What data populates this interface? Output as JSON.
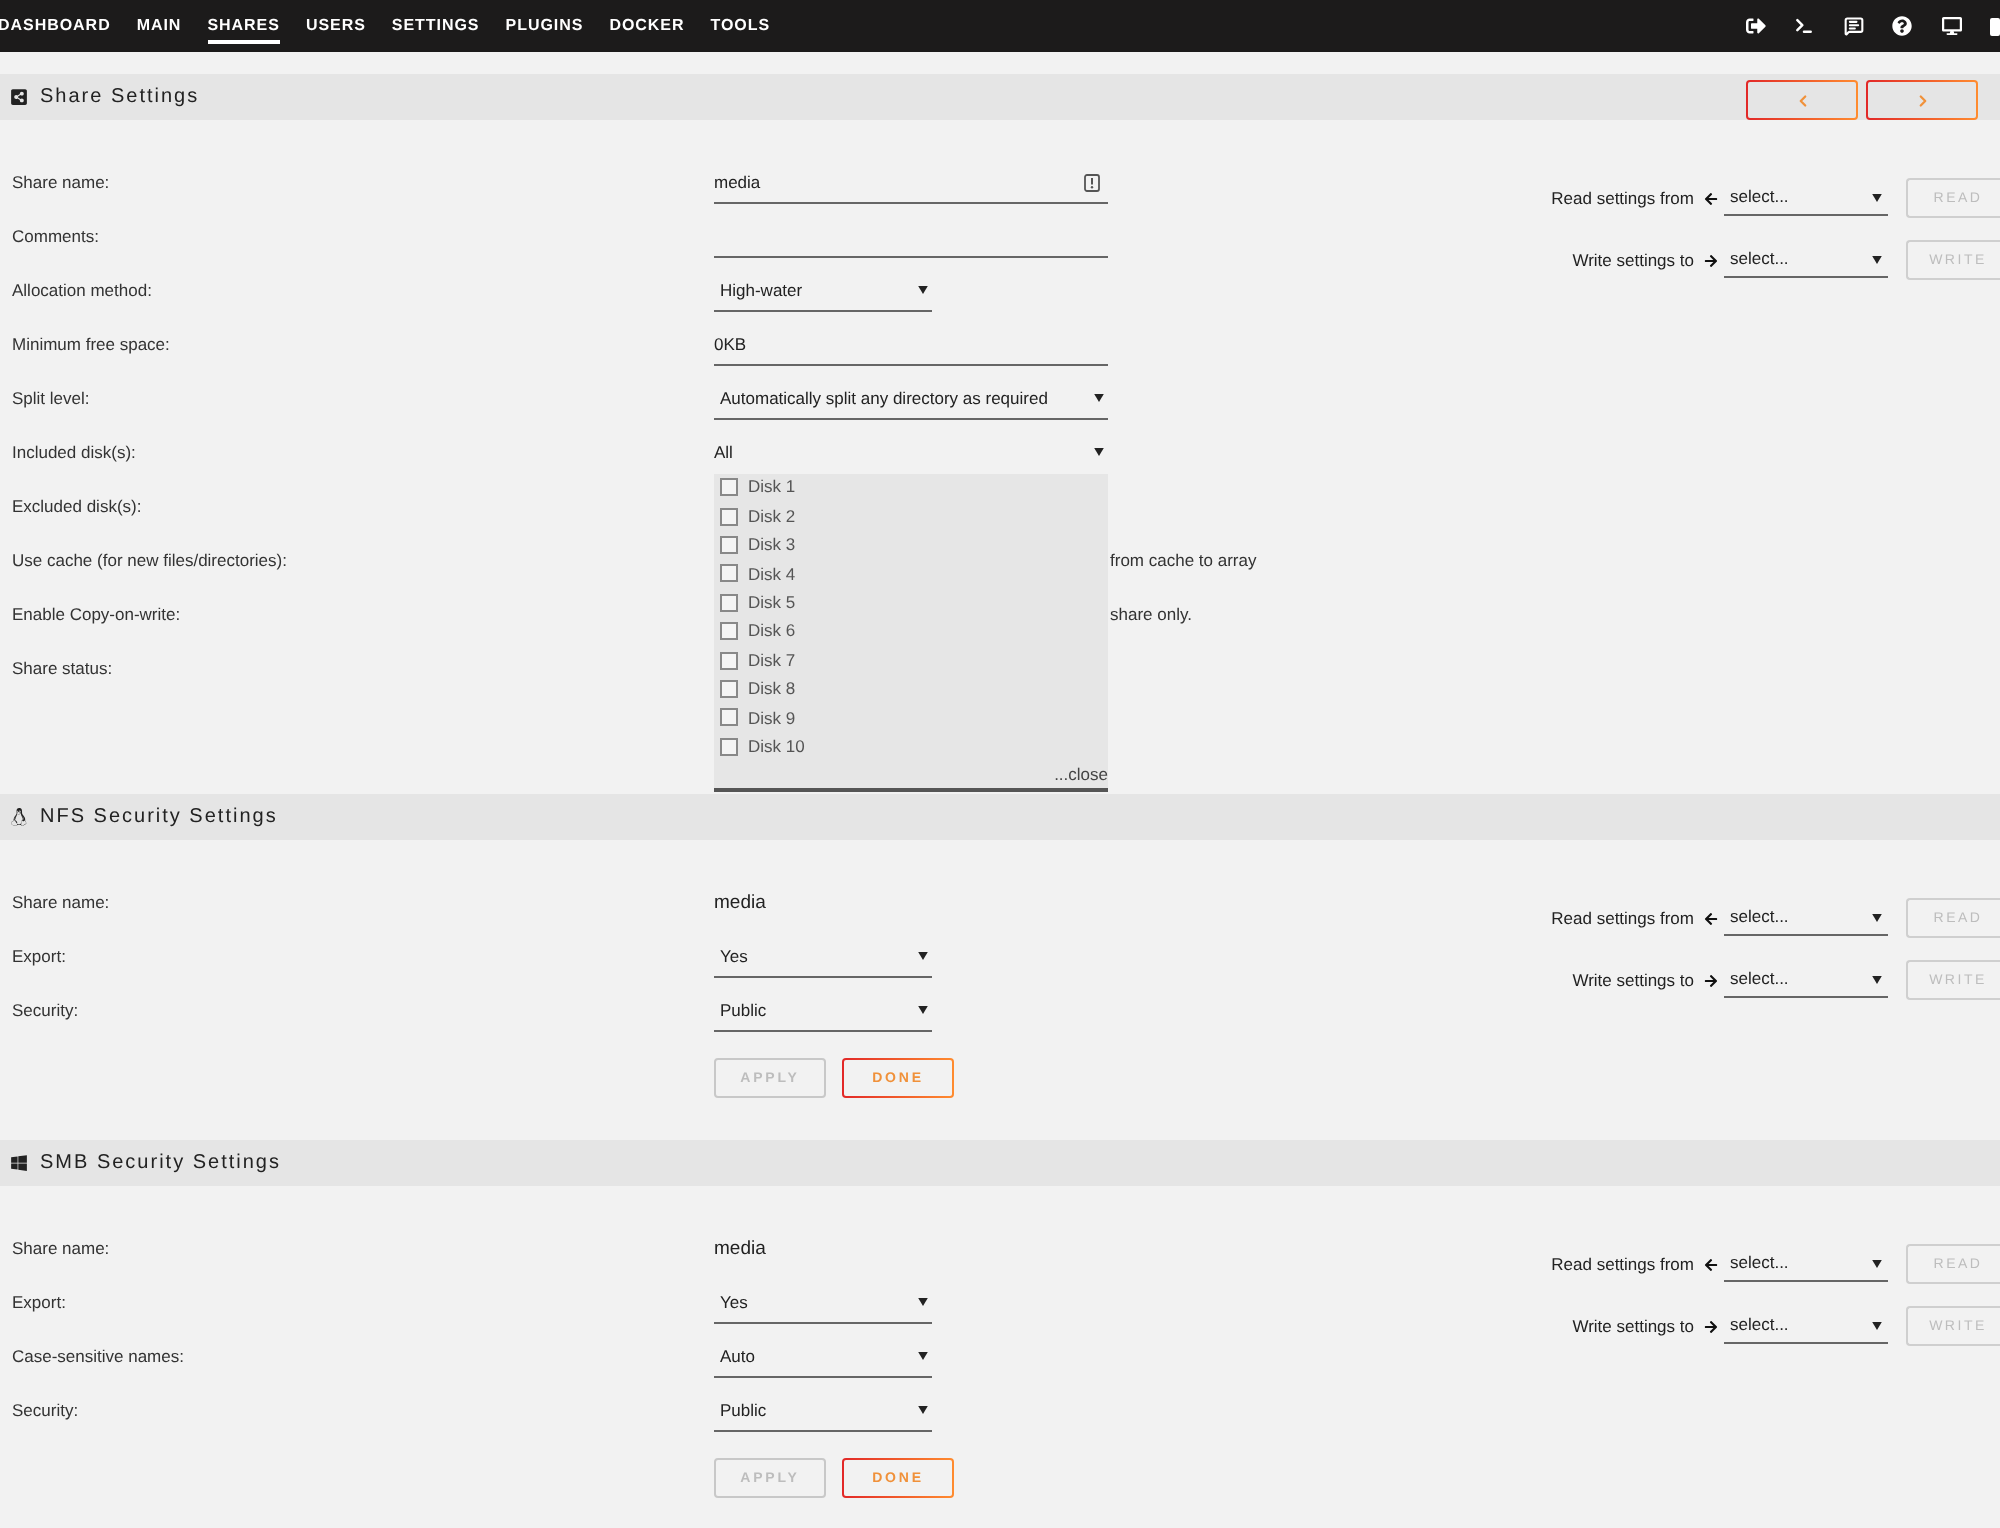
{
  "nav": {
    "items": [
      {
        "label": "DASHBOARD",
        "selected": false
      },
      {
        "label": "MAIN",
        "selected": false
      },
      {
        "label": "SHARES",
        "selected": true
      },
      {
        "label": "USERS",
        "selected": false
      },
      {
        "label": "SETTINGS",
        "selected": false
      },
      {
        "label": "PLUGINS",
        "selected": false
      },
      {
        "label": "DOCKER",
        "selected": false
      },
      {
        "label": "TOOLS",
        "selected": false
      }
    ]
  },
  "sections": [
    {
      "kind": "share",
      "title": "Share Settings",
      "pager": true,
      "rows": [
        {
          "kind": "input",
          "label": "Share name:",
          "value": "media",
          "hint_icon": true
        },
        {
          "kind": "input",
          "label": "Comments:"
        },
        {
          "kind": "select",
          "label": "Allocation method:",
          "value": "High-water"
        },
        {
          "kind": "input",
          "label": "Minimum free space:",
          "value": "0KB"
        },
        {
          "kind": "wideselect",
          "label": "Split level:",
          "value": "Automatically split any directory as required"
        },
        {
          "kind": "multiselect",
          "label": "Included disk(s):",
          "value": "All",
          "expanded": true,
          "options": [
            {
              "label": "Disk 1",
              "checked": false
            },
            {
              "label": "Disk 2",
              "checked": false
            },
            {
              "label": "Disk 3",
              "checked": false
            },
            {
              "label": "Disk 4",
              "checked": false
            },
            {
              "label": "Disk 5",
              "checked": false
            },
            {
              "label": "Disk 6",
              "checked": false
            },
            {
              "label": "Disk 7",
              "checked": false
            },
            {
              "label": "Disk 8",
              "checked": false
            },
            {
              "label": "Disk 9",
              "checked": false
            },
            {
              "label": "Disk 10",
              "checked": false
            }
          ],
          "close": "...close"
        },
        {
          "kind": "label",
          "label": "Excluded disk(s):"
        },
        {
          "kind": "label",
          "label": "Use cache (for new files/directories):",
          "note": "from cache to array"
        },
        {
          "kind": "label",
          "label": "Enable Copy-on-write:",
          "note": "share only."
        },
        {
          "kind": "label",
          "label": "Share status:"
        }
      ],
      "transfer": [
        {
          "kind": "read",
          "label": "Read settings from",
          "value": "select...",
          "button": "READ",
          "disabled": true
        },
        {
          "kind": "write",
          "label": "Write settings to",
          "value": "select...",
          "button": "WRITE",
          "disabled": true
        }
      ]
    },
    {
      "kind": "nfs",
      "title": "NFS Security Settings",
      "rows": [
        {
          "kind": "static",
          "label": "Share name:",
          "value": "media"
        },
        {
          "kind": "select",
          "label": "Export:",
          "value": "Yes"
        },
        {
          "kind": "select",
          "label": "Security:",
          "value": "Public"
        }
      ],
      "buttons": [
        {
          "label": "APPLY",
          "disabled": true
        },
        {
          "label": "DONE",
          "disabled": false
        }
      ],
      "transfer": [
        {
          "kind": "read",
          "label": "Read settings from",
          "value": "select...",
          "button": "READ",
          "disabled": true
        },
        {
          "kind": "write",
          "label": "Write settings to",
          "value": "select...",
          "button": "WRITE",
          "disabled": true
        }
      ]
    },
    {
      "kind": "smb",
      "title": "SMB Security Settings",
      "rows": [
        {
          "kind": "static",
          "label": "Share name:",
          "value": "media"
        },
        {
          "kind": "select",
          "label": "Export:",
          "value": "Yes"
        },
        {
          "kind": "select",
          "label": "Case-sensitive names:",
          "value": "Auto"
        },
        {
          "kind": "select",
          "label": "Security:",
          "value": "Public"
        }
      ],
      "buttons": [
        {
          "label": "APPLY",
          "disabled": true
        },
        {
          "label": "DONE",
          "disabled": false
        }
      ],
      "transfer": [
        {
          "kind": "read",
          "label": "Read settings from",
          "value": "select...",
          "button": "READ",
          "disabled": true
        },
        {
          "kind": "write",
          "label": "Write settings to",
          "value": "select...",
          "button": "WRITE",
          "disabled": true
        }
      ]
    }
  ]
}
